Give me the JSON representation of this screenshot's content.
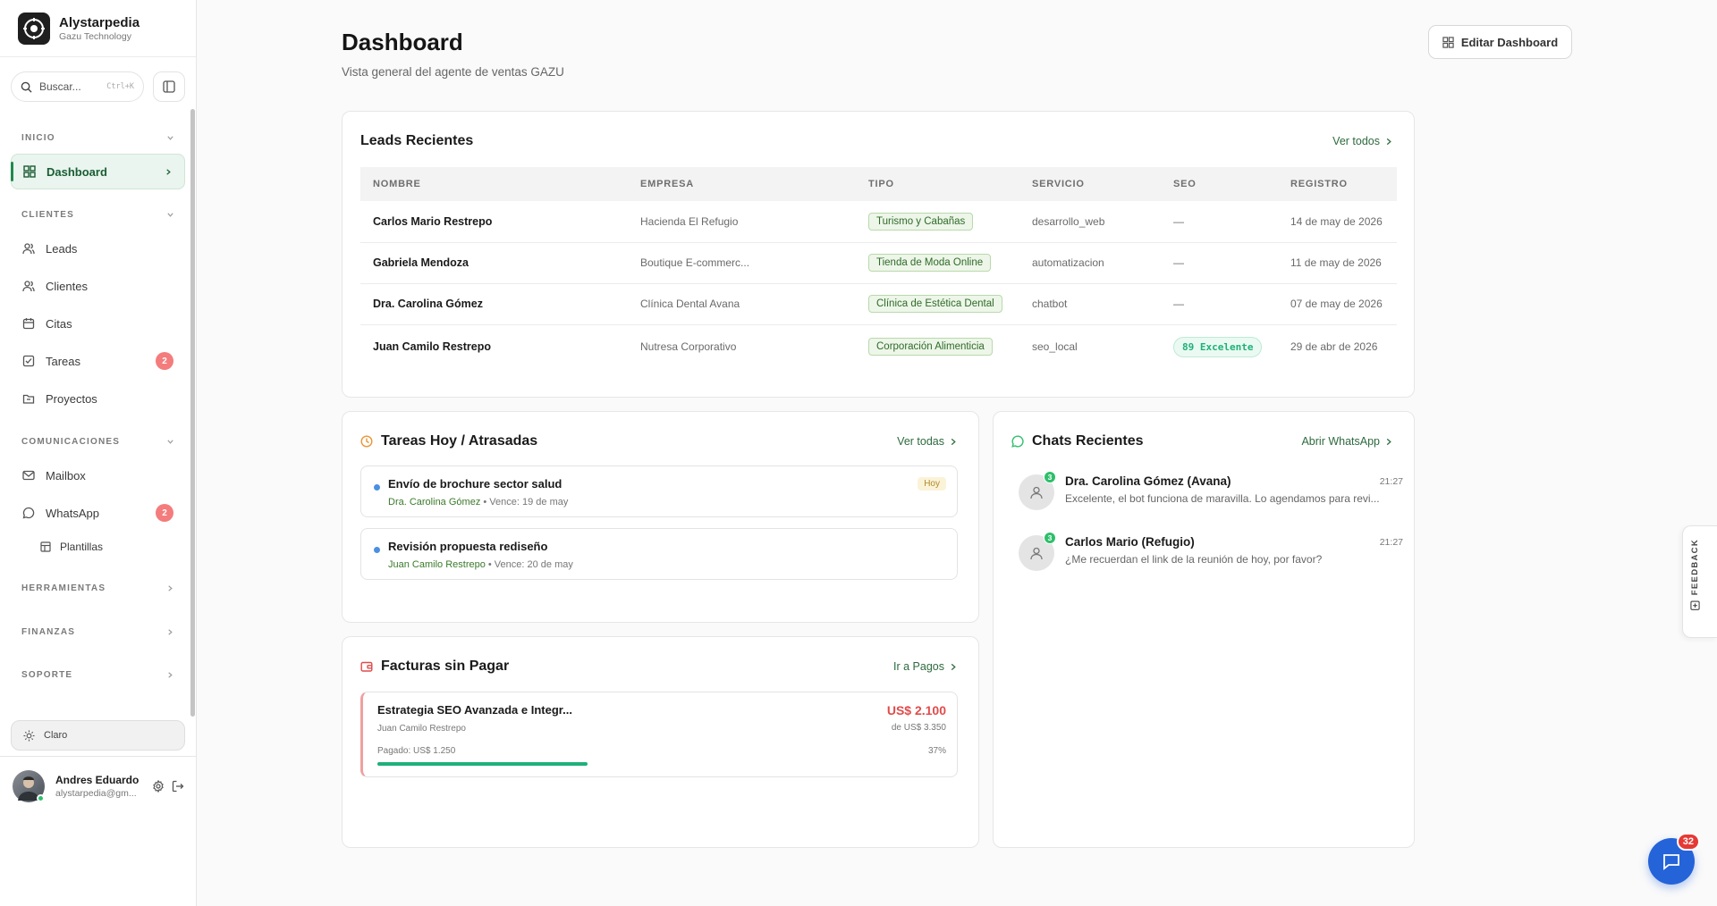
{
  "brand": {
    "name": "Alystarpedia",
    "subtitle": "Gazu Technology"
  },
  "search": {
    "placeholder": "Buscar...",
    "shortcut": "Ctrl+K"
  },
  "sections": {
    "inicio": "INICIO",
    "clientes": "CLIENTES",
    "comunicaciones": "COMUNICACIONES",
    "herramientas": "HERRAMIENTAS",
    "finanzas": "FINANZAS",
    "soporte": "SOPORTE"
  },
  "nav": {
    "dashboard": "Dashboard",
    "leads": "Leads",
    "clientes": "Clientes",
    "citas": "Citas",
    "tareas": "Tareas",
    "tareas_badge": "2",
    "proyectos": "Proyectos",
    "mailbox": "Mailbox",
    "whatsapp": "WhatsApp",
    "whatsapp_badge": "2",
    "plantillas": "Plantillas"
  },
  "theme": {
    "label": "Claro"
  },
  "user": {
    "name": "Andres Eduardo",
    "email": "alystarpedia@gm..."
  },
  "header": {
    "title": "Dashboard",
    "subtitle": "Vista general del agente de ventas GAZU",
    "edit_label": "Editar Dashboard"
  },
  "leads": {
    "title": "Leads Recientes",
    "link": "Ver todos",
    "columns": [
      "NOMBRE",
      "EMPRESA",
      "TIPO",
      "SERVICIO",
      "SEO",
      "REGISTRO"
    ],
    "rows": [
      {
        "nombre": "Carlos Mario Restrepo",
        "empresa": "Hacienda El Refugio",
        "tipo": "Turismo y Cabañas",
        "servicio": "desarrollo_web",
        "seo": "—",
        "registro": "14 de may de 2026"
      },
      {
        "nombre": "Gabriela Mendoza",
        "empresa": "Boutique E-commerc...",
        "tipo": "Tienda de Moda Online",
        "servicio": "automatizacion",
        "seo": "—",
        "registro": "11 de may de 2026"
      },
      {
        "nombre": "Dra. Carolina Gómez",
        "empresa": "Clínica Dental Avana",
        "tipo": "Clínica de Estética Dental",
        "servicio": "chatbot",
        "seo": "—",
        "registro": "07 de may de 2026"
      },
      {
        "nombre": "Juan Camilo Restrepo",
        "empresa": "Nutresa Corporativo",
        "tipo": "Corporación Alimenticia",
        "servicio": "seo_local",
        "seo": "89 Excelente",
        "registro": "29 de abr de 2026"
      }
    ]
  },
  "tasks": {
    "title": "Tareas Hoy / Atrasadas",
    "link": "Ver todas",
    "items": [
      {
        "title": "Envío de brochure sector salud",
        "who": "Dra. Carolina Gómez",
        "due": " • Vence: 19 de may",
        "pill": "Hoy"
      },
      {
        "title": "Revisión propuesta rediseño",
        "who": "Juan Camilo Restrepo",
        "due": " • Vence: 20 de may",
        "pill": ""
      }
    ]
  },
  "chats": {
    "title": "Chats Recientes",
    "link": "Abrir WhatsApp",
    "items": [
      {
        "name": "Dra. Carolina Gómez (Avana)",
        "time": "21:27",
        "message": "Excelente, el bot funciona de maravilla. Lo agendamos para revi...",
        "unread": "3"
      },
      {
        "name": "Carlos Mario (Refugio)",
        "time": "21:27",
        "message": "¿Me recuerdan el link de la reunión de hoy, por favor?",
        "unread": "3"
      }
    ]
  },
  "invoices": {
    "title": "Facturas sin Pagar",
    "link": "Ir a Pagos",
    "items": [
      {
        "title": "Estrategia SEO Avanzada e Integr...",
        "client": "Juan Camilo Restrepo",
        "amount": "US$ 2.100",
        "total": "de US$ 3.350",
        "paid": "Pagado: US$ 1.250",
        "percent_label": "37%",
        "percent": 37
      }
    ]
  },
  "feedback": {
    "label": "FEEDBACK"
  },
  "fab": {
    "badge": "32"
  },
  "colors": {
    "accent": "#2d6a3e",
    "danger": "#e14b4b",
    "success": "#1fb07a",
    "fab": "#2563d9"
  }
}
